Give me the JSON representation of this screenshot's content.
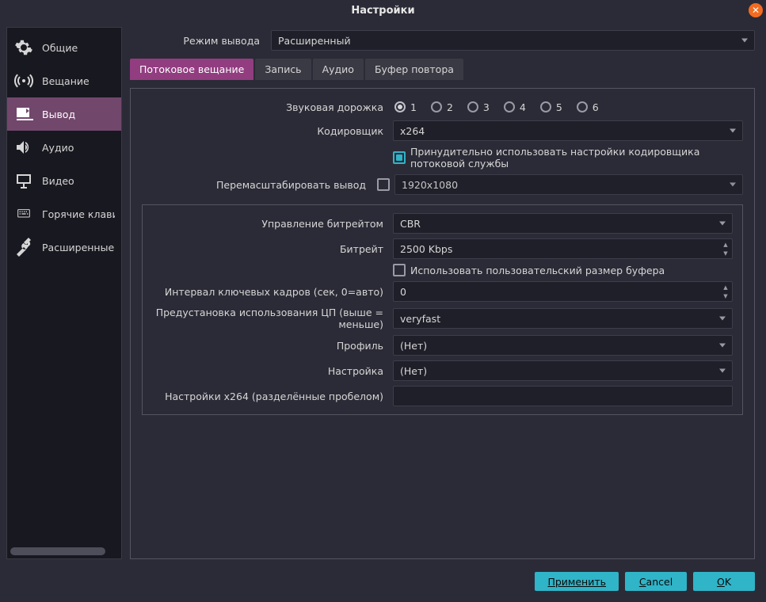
{
  "title": "Настройки",
  "sidebar": {
    "items": [
      {
        "label": "Общие"
      },
      {
        "label": "Вещание"
      },
      {
        "label": "Вывод"
      },
      {
        "label": "Аудио"
      },
      {
        "label": "Видео"
      },
      {
        "label": "Горячие клавиши"
      },
      {
        "label": "Расширенные"
      }
    ],
    "active_index": 2
  },
  "output_mode": {
    "label": "Режим вывода",
    "value": "Расширенный"
  },
  "tabs": {
    "items": [
      "Потоковое вещание",
      "Запись",
      "Аудио",
      "Буфер повтора"
    ],
    "active_index": 0
  },
  "audio_track": {
    "label": "Звуковая дорожка",
    "options": [
      "1",
      "2",
      "3",
      "4",
      "5",
      "6"
    ],
    "selected": 0
  },
  "encoder": {
    "label": "Кодировщик",
    "value": "x264"
  },
  "enforce": {
    "label": "Принудительно использовать настройки кодировщика потоковой службы",
    "checked": true
  },
  "rescale": {
    "label": "Перемасштабировать вывод",
    "checked": false,
    "value": "1920x1080"
  },
  "rate_control": {
    "label": "Управление битрейтом",
    "value": "CBR"
  },
  "bitrate": {
    "label": "Битрейт",
    "value": "2500 Kbps"
  },
  "custom_buffer": {
    "label": "Использовать пользовательский размер буфера",
    "checked": false
  },
  "keyframe": {
    "label": "Интервал ключевых кадров (сек, 0=авто)",
    "value": "0"
  },
  "preset": {
    "label": "Предустановка использования ЦП (выше = меньше)",
    "value": "veryfast"
  },
  "profile": {
    "label": "Профиль",
    "value": "(Нет)"
  },
  "tune": {
    "label": "Настройка",
    "value": "(Нет)"
  },
  "x264opts": {
    "label": "Настройки x264 (разделённые пробелом)",
    "value": ""
  },
  "footer": {
    "apply": "Применить",
    "cancel_first": "C",
    "cancel_rest": "ancel",
    "ok_first": "O",
    "ok_rest": "K"
  }
}
